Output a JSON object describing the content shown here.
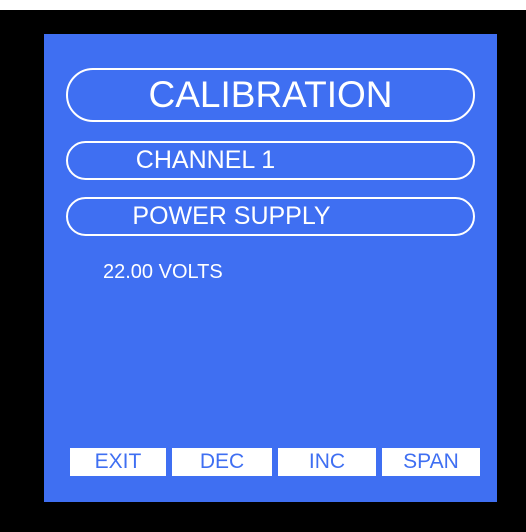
{
  "screen": {
    "title": "CALIBRATION",
    "channel": "CHANNEL 1",
    "mode": "POWER SUPPLY",
    "reading": "22.00 VOLTS"
  },
  "softkeys": [
    {
      "label": "EXIT"
    },
    {
      "label": "DEC"
    },
    {
      "label": "INC"
    },
    {
      "label": "SPAN"
    }
  ],
  "colors": {
    "screen_background": "#3f6ff2",
    "bezel": "#000000",
    "text": "#ffffff"
  }
}
